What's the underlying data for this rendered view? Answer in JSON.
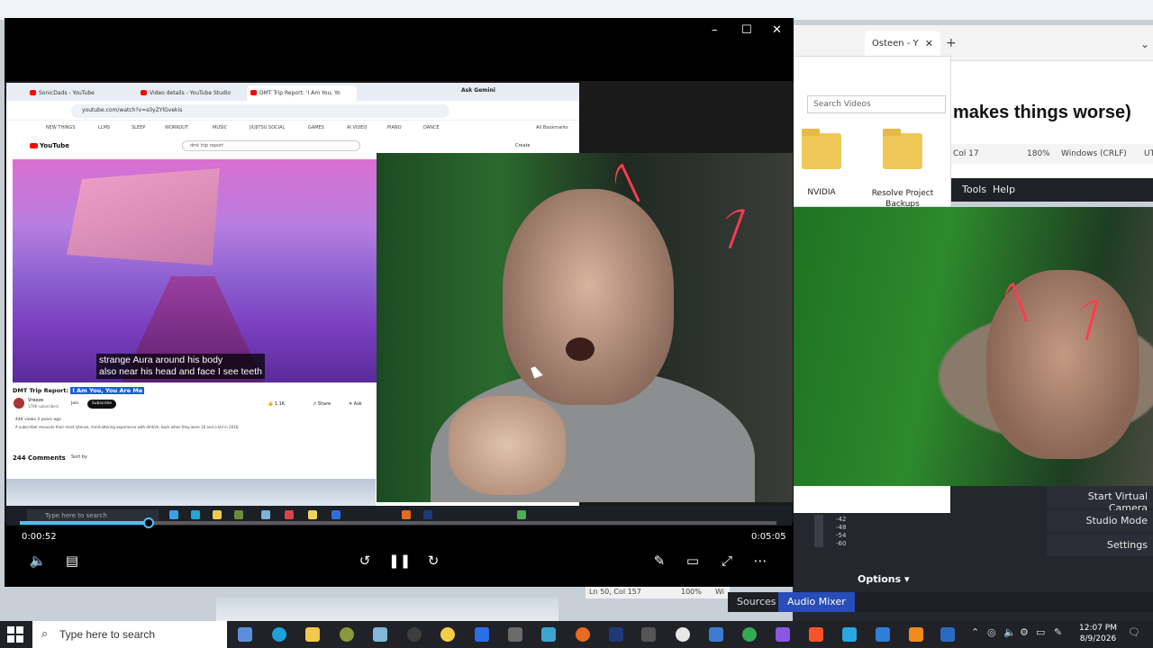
{
  "background": {
    "browser_tab": "Osteen - Y",
    "editor_heading": "makes things worse)",
    "editor_status": [
      "Col 17",
      "180%",
      "Windows (CRLF)",
      "UT"
    ],
    "editor_menu": [
      "Tools",
      "Help"
    ],
    "explorer_search_placeholder": "Search Videos",
    "folders": [
      "NVIDIA",
      "Resolve Project Backups"
    ],
    "obs_buttons": [
      "Start Virtual Camera",
      "Studio Mode",
      "Settings"
    ],
    "obs_options": "Options",
    "obs_tabs": [
      "Sources",
      "Audio Mixer"
    ],
    "meter_labels": [
      "-42",
      "-48",
      "-54",
      "-60"
    ],
    "notepad_status": [
      "Ln 50, Col 157",
      "100%",
      "Wi"
    ]
  },
  "inner_browser": {
    "tabs": [
      "SonicDads - YouTube",
      "Video details - YouTube Studio",
      "DMT Trip Report: 'I Am You, Yo"
    ],
    "ask_gemini": "Ask Gemini",
    "url": "youtube.com/watch?v=s0yZYlGvekis",
    "bookmarks": [
      "NEW THINGS",
      "LLMS",
      "SLEEP",
      "WORKOUT",
      "MUSIC",
      "JIUJITSU SOCIAL",
      "GAMES",
      "AI VIDEO",
      "PIANO",
      "DANCE"
    ],
    "all_bookmarks": "All Bookmarks",
    "yt_logo": "YouTube",
    "yt_search": "dmt trip report",
    "create": "Create",
    "subtitle_line1": "strange Aura around his body",
    "subtitle_line2": "also near his head and face I see teeth",
    "title_prefix": "DMT Trip Report:",
    "title_highlight": "I Am You, You Are Me",
    "channel": "Vreeze",
    "subscribers": "178K subscribers",
    "join": "Join",
    "subscribe": "Subscribe",
    "likes": "1.1K",
    "share": "Share",
    "ask": "Ask",
    "views": "44K views 3 years ago",
    "description": "A subscriber recounts their most intense, mind-altering experience with dmt/ch, back when they were 16 and a kid in 2016.",
    "comments_count": "244 Comments",
    "sort_by": "Sort by",
    "inner_search": "Type here to search"
  },
  "player": {
    "current_time": "0:00:52",
    "duration": "0:05:05",
    "progress": 0.17,
    "controls": [
      "volume",
      "captions",
      "rewind-10",
      "pause",
      "forward-30",
      "edit",
      "mini-player",
      "fullscreen",
      "more"
    ]
  },
  "taskbar": {
    "search_placeholder": "Type here to search",
    "time": "12:07 PM",
    "date": "8/9/2026"
  }
}
